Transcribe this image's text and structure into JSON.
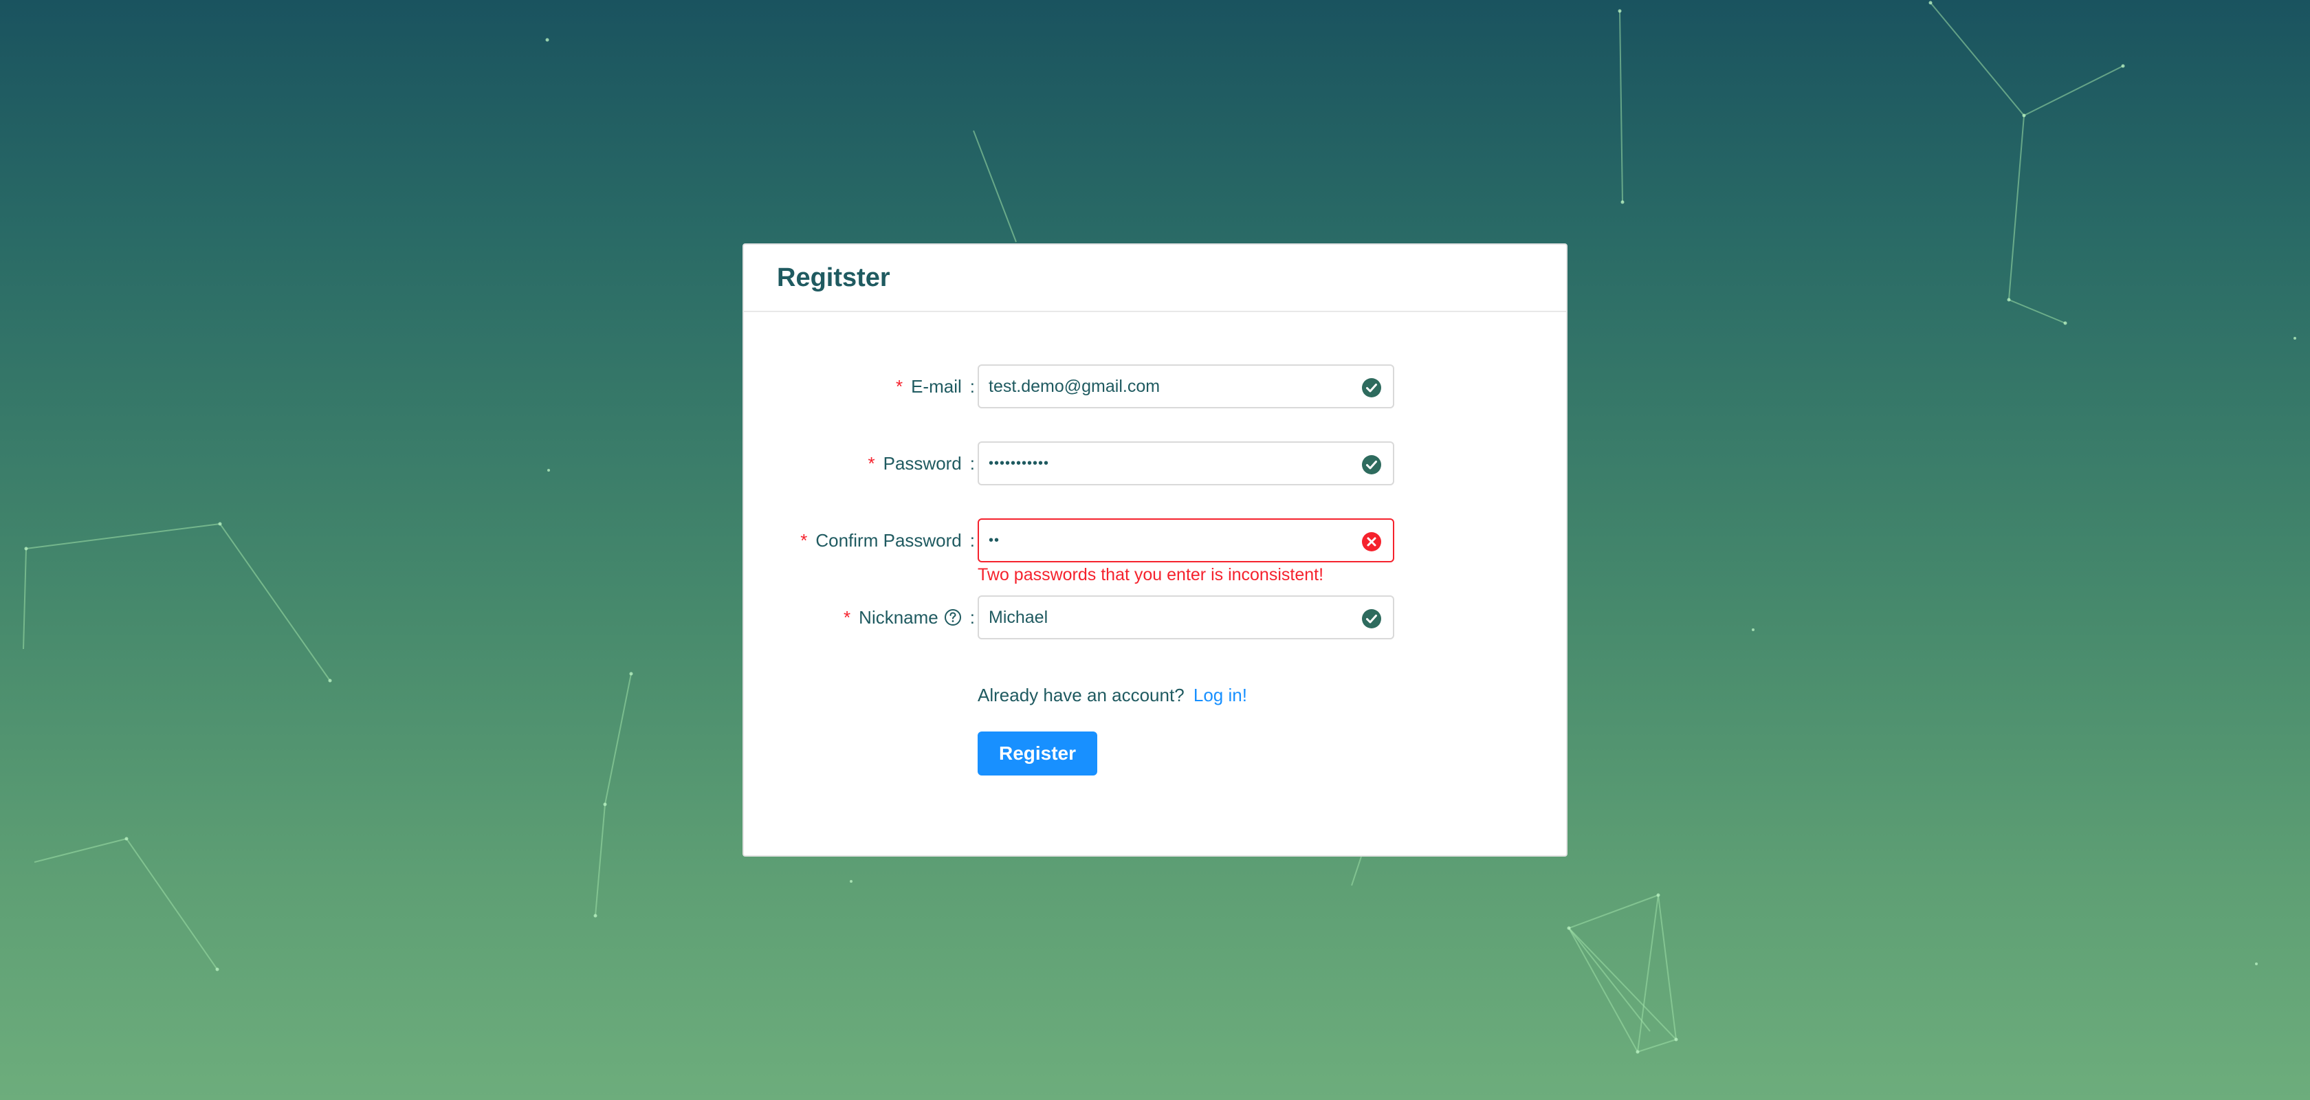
{
  "card": {
    "title": "Regitster"
  },
  "form": {
    "email": {
      "label": "E-mail",
      "value": "test.demo@gmail.com",
      "status": "success"
    },
    "password": {
      "label": "Password",
      "value": "•••••••••••",
      "status": "success"
    },
    "confirm": {
      "label": "Confirm Password",
      "value": "••",
      "status": "error",
      "error": "Two passwords that you enter is inconsistent!"
    },
    "nickname": {
      "label": "Nickname",
      "value": "Michael",
      "status": "success",
      "help_icon": "question-circle-icon"
    }
  },
  "login": {
    "prompt": "Already have an account?",
    "link": "Log in!"
  },
  "submit": {
    "label": "Register"
  },
  "colors": {
    "primary": "#1890ff",
    "error": "#f5222d",
    "success": "#2e6b5e",
    "text": "#1f5a60"
  },
  "icons": {
    "success": "check-circle-icon",
    "error": "close-circle-icon"
  }
}
